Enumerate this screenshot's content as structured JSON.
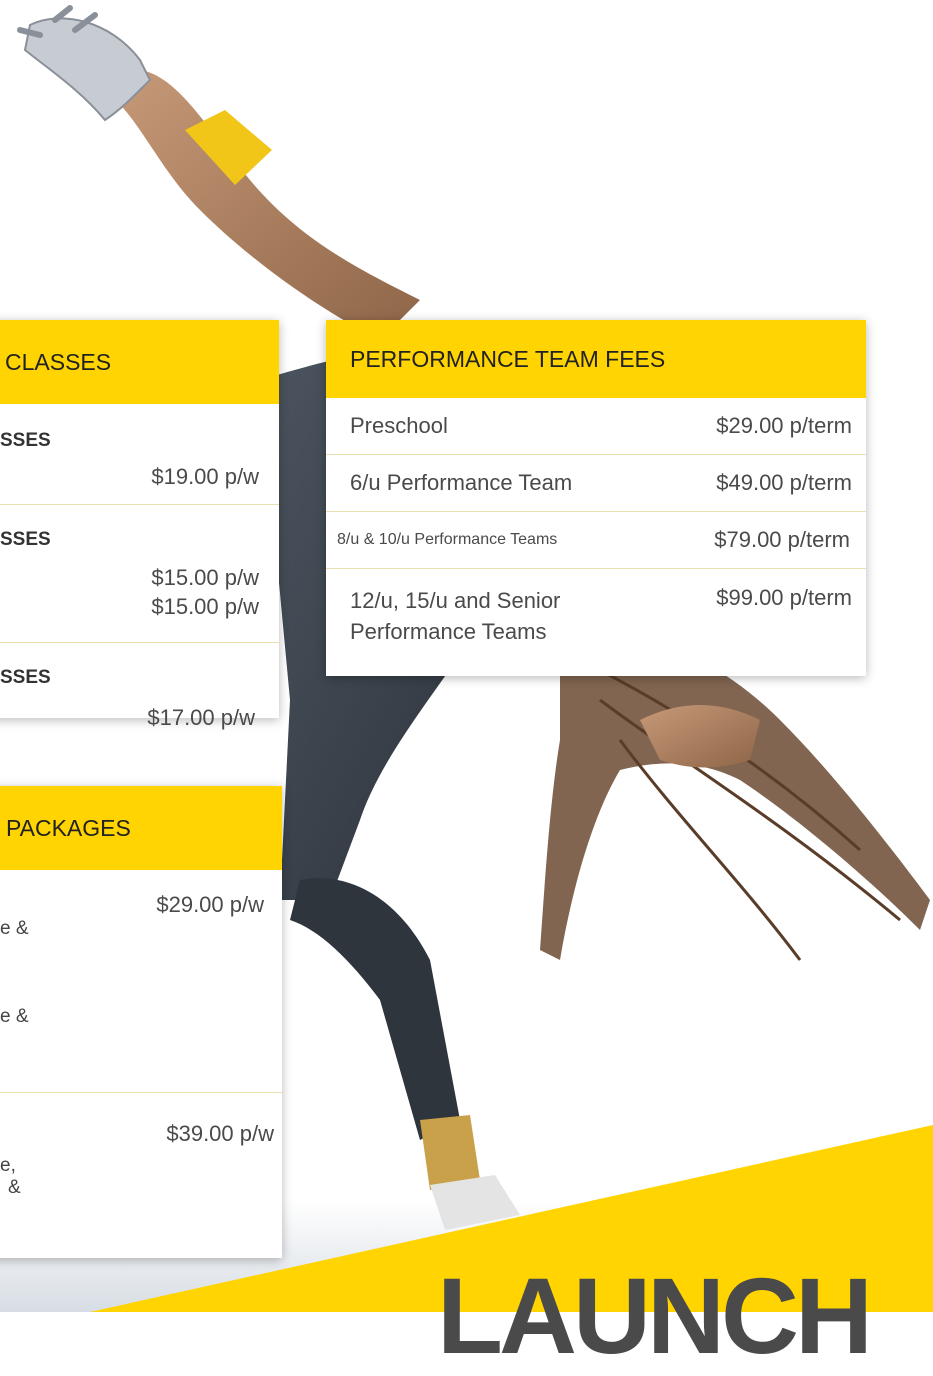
{
  "colors": {
    "accent": "#ffd400",
    "text": "#4a4a4a",
    "divider": "#e9dfb0"
  },
  "performance_fees": {
    "title": "PERFORMANCE TEAM FEES",
    "rows": [
      {
        "label": "Preschool",
        "price": "$29.00 p/term"
      },
      {
        "label": "6/u Performance Team",
        "price": "$49.00 p/term"
      },
      {
        "label": "8/u & 10/u Performance Teams",
        "price": "$79.00 p/term"
      },
      {
        "label_line1": "12/u, 15/u and Senior",
        "label_line2": "Performance Teams",
        "price": "$99.00 p/term"
      }
    ]
  },
  "classes": {
    "title": "CLASSES",
    "sections": [
      {
        "heading": "SSES",
        "prices": [
          "$19.00 p/w"
        ]
      },
      {
        "heading": "SSES",
        "prices": [
          "$15.00 p/w",
          "$15.00 p/w"
        ]
      },
      {
        "heading": "SSES",
        "prices": [
          "$17.00 p/w"
        ]
      }
    ]
  },
  "packages": {
    "title": "PACKAGES",
    "items": [
      {
        "price": "$29.00 p/w",
        "fragments": [
          "e &",
          "e &"
        ]
      },
      {
        "price": "$39.00 p/w",
        "fragments": [
          "e,",
          "&"
        ]
      }
    ]
  },
  "footer": {
    "brand": "LAUNCH"
  }
}
